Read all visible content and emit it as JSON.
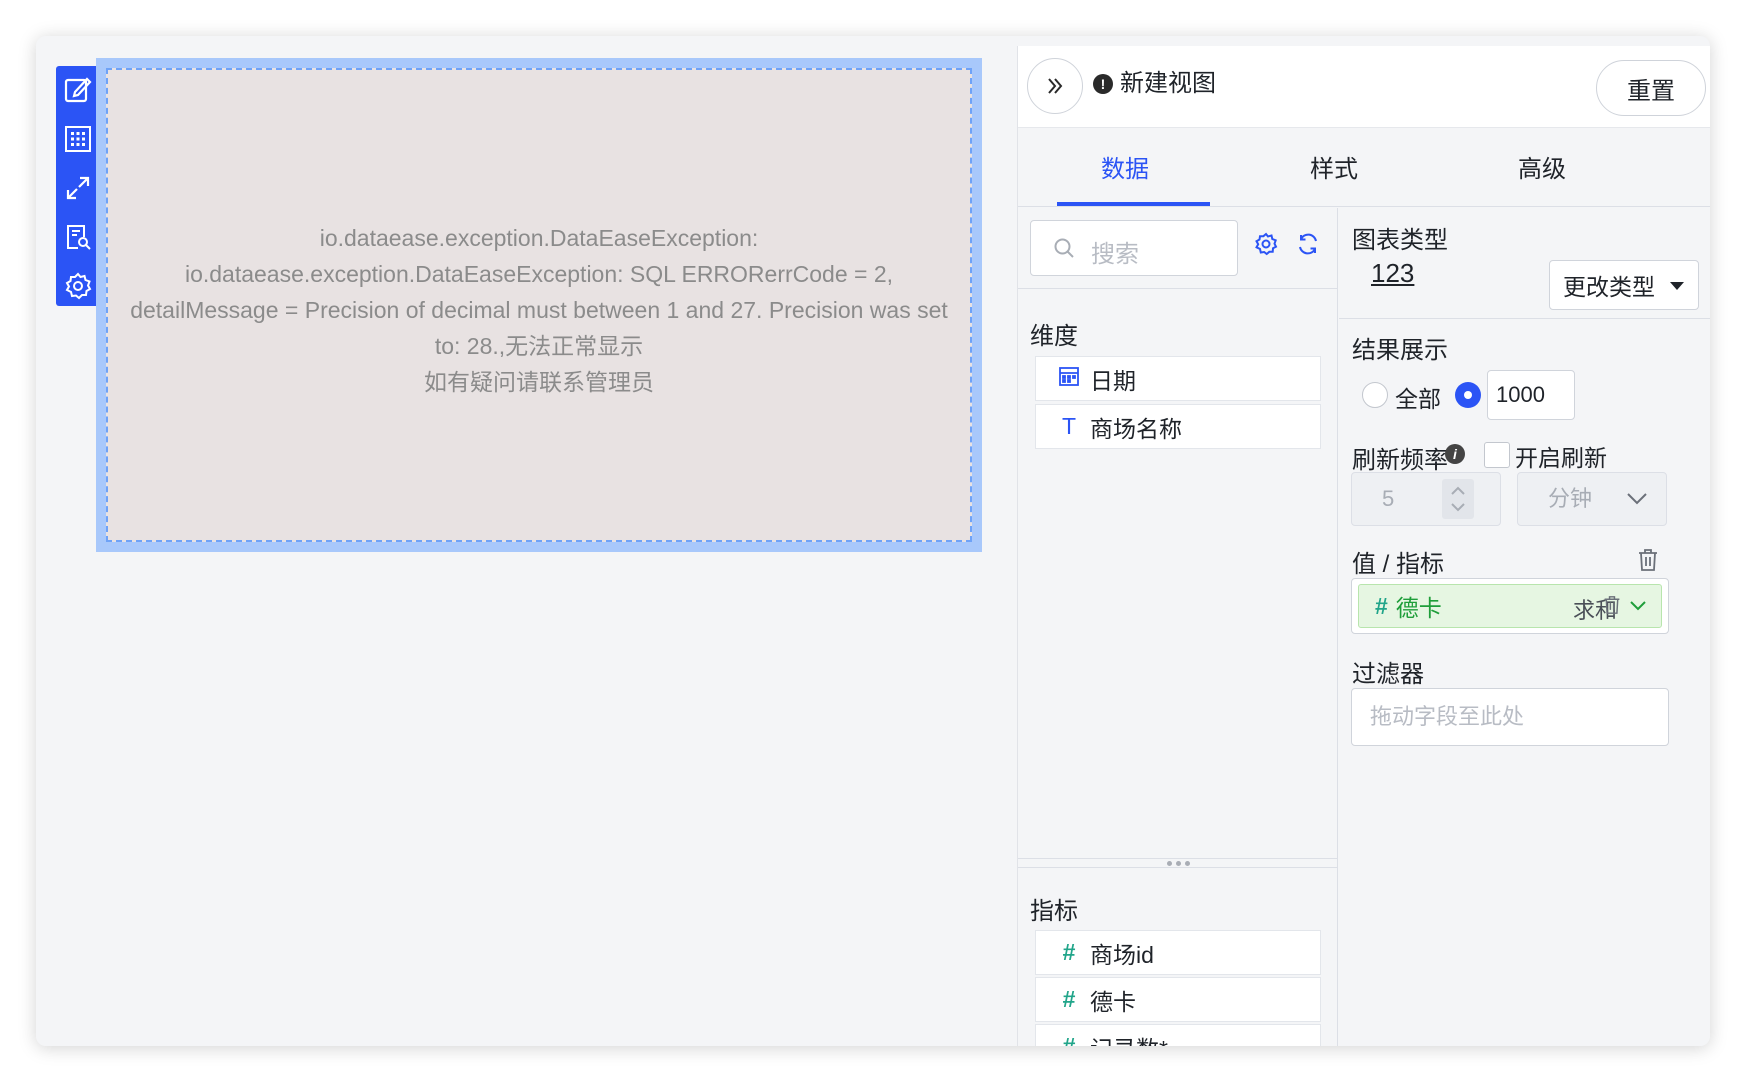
{
  "canvas": {
    "toolbar": [
      "edit-icon",
      "grid-icon",
      "expand-icon",
      "inspect-icon",
      "settings-icon"
    ],
    "error_lines": [
      "io.dataease.exception.DataEaseException:",
      "io.dataease.exception.DataEaseException: SQL ERRORerrCode = 2,",
      "detailMessage = Precision of decimal must between 1 and 27. Precision was set",
      "to: 28.,无法正常显示",
      "如有疑问请联系管理员"
    ]
  },
  "header": {
    "title": "新建视图",
    "reset_label": "重置"
  },
  "tabs": [
    "数据",
    "样式",
    "高级"
  ],
  "fields": {
    "search_placeholder": "搜索",
    "dimension_title": "维度",
    "dimensions": [
      {
        "label": "日期",
        "icon": "calendar-icon"
      },
      {
        "label": "商场名称",
        "icon": "text-type-icon"
      }
    ],
    "measure_title": "指标",
    "measures": [
      {
        "label": "商场id",
        "icon": "hash-icon"
      },
      {
        "label": "德卡",
        "icon": "hash-icon"
      },
      {
        "label": "记录数*",
        "icon": "hash-icon"
      }
    ]
  },
  "settings": {
    "chart_type_title": "图表类型",
    "chart_type_glyph": "123",
    "change_type_label": "更改类型",
    "result_title": "结果展示",
    "result_all_label": "全部",
    "result_limit_value": "1000",
    "refresh_title": "刷新频率",
    "refresh_enable_label": "开启刷新",
    "refresh_interval": "5",
    "refresh_unit": "分钟",
    "value_title": "值 / 指标",
    "value_field": "德卡",
    "value_agg": "求和",
    "filter_title": "过滤器",
    "filter_placeholder": "拖动字段至此处"
  },
  "colors": {
    "accent": "#2b54f5",
    "measure": "#21a58a",
    "chip_bg": "#e6f6e2"
  }
}
